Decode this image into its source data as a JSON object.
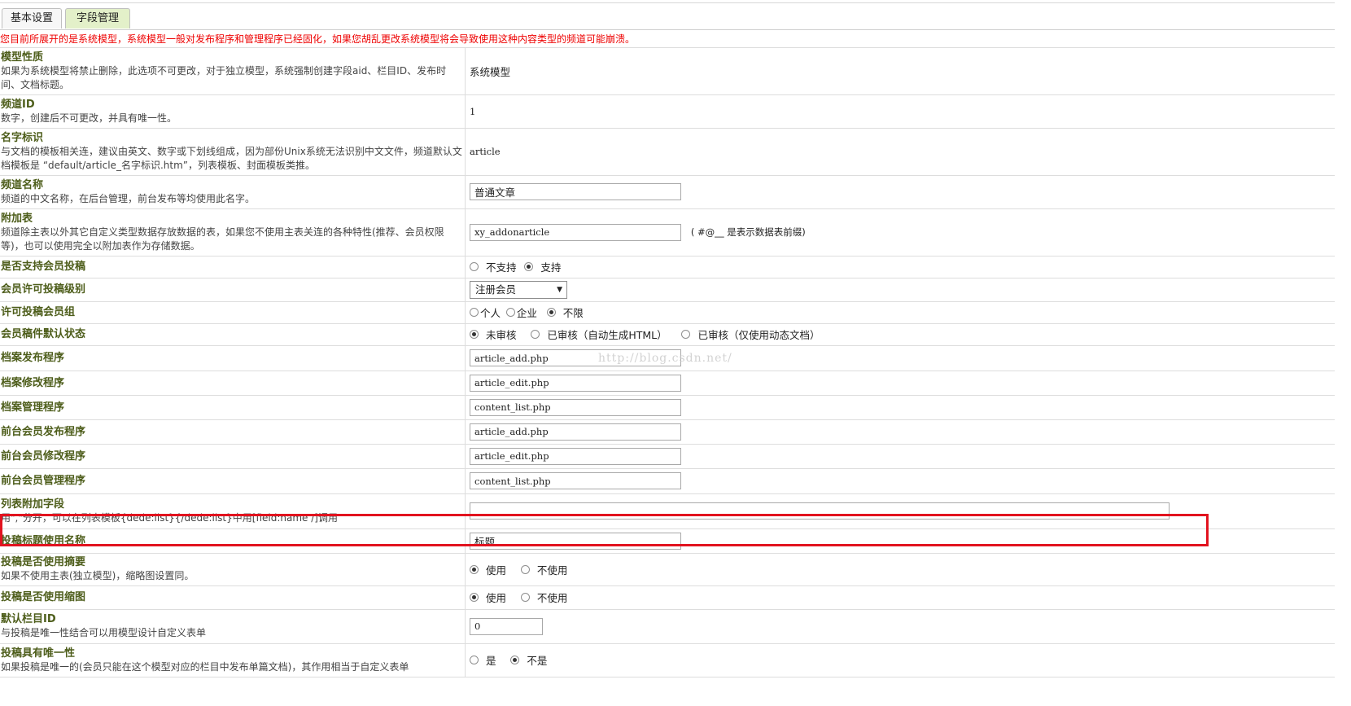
{
  "tabs": [
    {
      "label": "基本设置"
    },
    {
      "label": "字段管理"
    }
  ],
  "warning": "您目前所展开的是系统模型，系统模型一般对发布程序和管理程序已经固化，如果您胡乱更改系统模型将会导致使用这种内容类型的频道可能崩溃。",
  "rows": {
    "model_type": {
      "title": "模型性质",
      "desc": "如果为系统模型将禁止删除，此选项不可更改，对于独立模型，系统强制创建字段aid、栏目ID、发布时间、文档标题。",
      "value": "系统模型"
    },
    "channel_id": {
      "title": "频道ID",
      "desc": "数字，创建后不可更改，并具有唯一性。",
      "value": "1"
    },
    "name_tag": {
      "title": "名字标识",
      "desc": "与文档的模板相关连，建议由英文、数字或下划线组成，因为部份Unix系统无法识别中文文件，频道默认文档模板是 “default/article_名字标识.htm”，列表模板、封面模板类推。",
      "value": "article"
    },
    "channel_name": {
      "title": "频道名称",
      "desc": "频道的中文名称，在后台管理，前台发布等均使用此名字。",
      "value": "普通文章"
    },
    "addon_table": {
      "title": "附加表",
      "desc": "频道除主表以外其它自定义类型数据存放数据的表，如果您不使用主表关连的各种特性(推荐、会员权限等)，也可以使用完全以附加表作为存储数据。",
      "value": "xy_addonarticle",
      "hint": "( #@__ 是表示数据表前缀)"
    },
    "member_submit": {
      "title": "是否支持会员投稿",
      "options": [
        "不支持",
        "支持"
      ],
      "selected": 1
    },
    "member_level": {
      "title": "会员许可投稿级别",
      "selected_label": "注册会员"
    },
    "member_group": {
      "title": "许可投稿会员组",
      "options": [
        "个人",
        "企业",
        "不限"
      ],
      "selected": 2
    },
    "default_status": {
      "title": "会员稿件默认状态",
      "options": [
        "未审核",
        "已审核（自动生成HTML）",
        "已审核（仅使用动态文档）"
      ],
      "selected": 0
    },
    "add_program": {
      "title": "档案发布程序",
      "value": "article_add.php"
    },
    "edit_program": {
      "title": "档案修改程序",
      "value": "article_edit.php"
    },
    "manage_program": {
      "title": "档案管理程序",
      "value": "content_list.php"
    },
    "front_add": {
      "title": "前台会员发布程序",
      "value": "article_add.php"
    },
    "front_edit": {
      "title": "前台会员修改程序",
      "value": "article_edit.php"
    },
    "front_manage": {
      "title": "前台会员管理程序",
      "value": "content_list.php"
    },
    "list_fields": {
      "title": "列表附加字段",
      "desc": "用\",\"分开，可以在列表模板{dede:list}{/dede:list}中用[field:name /]调用",
      "value": ""
    },
    "submit_title_name": {
      "title": "投稿标题使用名称",
      "value": "标题"
    },
    "use_summary": {
      "title": "投稿是否使用摘要",
      "desc": "如果不使用主表(独立模型)，缩略图设置同。",
      "options": [
        "使用",
        "不使用"
      ],
      "selected": 0
    },
    "use_thumb": {
      "title": "投稿是否使用缩图",
      "options": [
        "使用",
        "不使用"
      ],
      "selected": 0
    },
    "default_typeid": {
      "title": "默认栏目ID",
      "desc": "与投稿是唯一性结合可以用模型设计自定义表单",
      "value": "0"
    },
    "unique": {
      "title": "投稿具有唯一性",
      "desc": "如果投稿是唯一的(会员只能在这个模型对应的栏目中发布单篇文档)，其作用相当于自定义表单",
      "options": [
        "是",
        "不是"
      ],
      "selected": 1
    }
  },
  "watermark": "http://blog.csdn.net/",
  "colors": {
    "warning": "#ee0000",
    "label": "#4d5d1a",
    "highlight": "#e2131f",
    "active_tab": "#e3f0c9"
  }
}
